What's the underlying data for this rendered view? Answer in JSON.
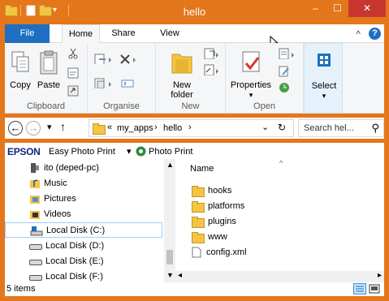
{
  "window": {
    "title": "hello",
    "minimize_glyph": "–",
    "maximize_glyph": "☐",
    "close_glyph": "✕"
  },
  "ribbon_tabs": {
    "file": "File",
    "home": "Home",
    "share": "Share",
    "view": "View",
    "collapse_glyph": "^",
    "help_glyph": "?"
  },
  "ribbon": {
    "clipboard": {
      "label": "Clipboard",
      "copy": "Copy",
      "paste": "Paste"
    },
    "organise": {
      "label": "Organise"
    },
    "new": {
      "label": "New",
      "new_folder_line1": "New",
      "new_folder_line2": "folder"
    },
    "open": {
      "label": "Open",
      "properties": "Properties"
    },
    "select": {
      "select": "Select"
    }
  },
  "address": {
    "back_glyph": "←",
    "forward_glyph": "→",
    "recent_glyph": "▾",
    "up_glyph": "↑",
    "overflow": "«",
    "crumbs": [
      "my_apps",
      "hello"
    ],
    "separator_glyph": "›",
    "dropdown_glyph": "⌄",
    "refresh_glyph": "↻",
    "search_placeholder": "Search hel...",
    "search_icon_glyph": "⚲"
  },
  "toolbar": {
    "brand": "EPSON",
    "easy_photo_print": "Easy Photo Print",
    "dropdown_glyph": "▾",
    "photo_print": "Photo Print"
  },
  "nav_tree": {
    "items": [
      {
        "label": "ito (deped-pc)",
        "icon": "network-computer-icon"
      },
      {
        "label": "Music",
        "icon": "music-folder-icon"
      },
      {
        "label": "Pictures",
        "icon": "pictures-folder-icon"
      },
      {
        "label": "Videos",
        "icon": "videos-folder-icon"
      },
      {
        "label": "Local Disk (C:)",
        "icon": "system-drive-icon"
      },
      {
        "label": "Local Disk (D:)",
        "icon": "drive-icon"
      },
      {
        "label": "Local Disk (E:)",
        "icon": "drive-icon"
      },
      {
        "label": "Local Disk (F:)",
        "icon": "drive-icon"
      }
    ],
    "selected": "Local Disk (C:)"
  },
  "file_list": {
    "column_name": "Name",
    "sort_glyph": "^",
    "items": [
      {
        "name": "hooks",
        "type": "folder"
      },
      {
        "name": "platforms",
        "type": "folder"
      },
      {
        "name": "plugins",
        "type": "folder"
      },
      {
        "name": "www",
        "type": "folder"
      },
      {
        "name": "config.xml",
        "type": "file"
      }
    ]
  },
  "status": {
    "item_count": "5 items"
  },
  "colors": {
    "title_bar": "#e4761b",
    "file_tab": "#1e6fc1",
    "close_button": "#c7372f",
    "folder": "#f5c542",
    "selection_border": "#99d1ff"
  }
}
